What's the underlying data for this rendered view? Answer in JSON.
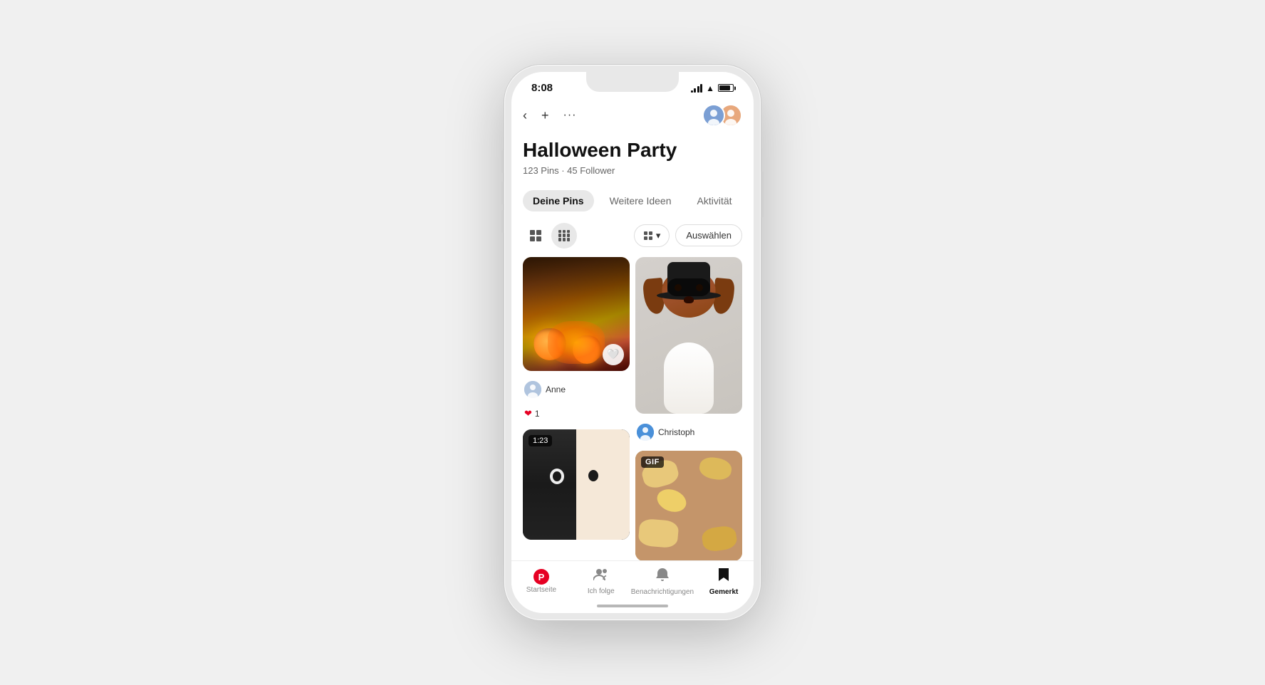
{
  "phone": {
    "time": "8:08",
    "signal_bars": [
      3,
      6,
      9,
      12
    ],
    "battery_level": 85
  },
  "header": {
    "back_label": "‹",
    "add_label": "+",
    "more_label": "···"
  },
  "board": {
    "title": "Halloween Party",
    "pins_count": "123",
    "followers_count": "45",
    "meta_text": "123 Pins · 45 Follower"
  },
  "tabs": [
    {
      "id": "deine-pins",
      "label": "Deine Pins",
      "active": true
    },
    {
      "id": "weitere-ideen",
      "label": "Weitere Ideen",
      "active": false
    },
    {
      "id": "aktivitaet",
      "label": "Aktivität",
      "active": false
    }
  ],
  "toolbar": {
    "sort_icon": "⊞",
    "select_label": "Auswählen"
  },
  "pins": [
    {
      "id": "pin-1",
      "type": "pumpkins",
      "user": "Anne",
      "likes": "1",
      "has_heart": true
    },
    {
      "id": "pin-2",
      "type": "dog",
      "user": "Christoph",
      "likes": null
    },
    {
      "id": "pin-3",
      "type": "horror-face",
      "duration": "1:23"
    },
    {
      "id": "pin-4",
      "type": "cookies",
      "badge": "GIF"
    }
  ],
  "bottom_nav": [
    {
      "id": "startseite",
      "label": "Startseite",
      "icon": "pinterest",
      "active": false
    },
    {
      "id": "ich-folge",
      "label": "Ich folge",
      "icon": "people",
      "active": false
    },
    {
      "id": "benachrichtigungen",
      "label": "Benachrichtigungen",
      "icon": "bell",
      "active": false
    },
    {
      "id": "gemerkt",
      "label": "Gemerkt",
      "icon": "bookmark",
      "active": true
    }
  ]
}
